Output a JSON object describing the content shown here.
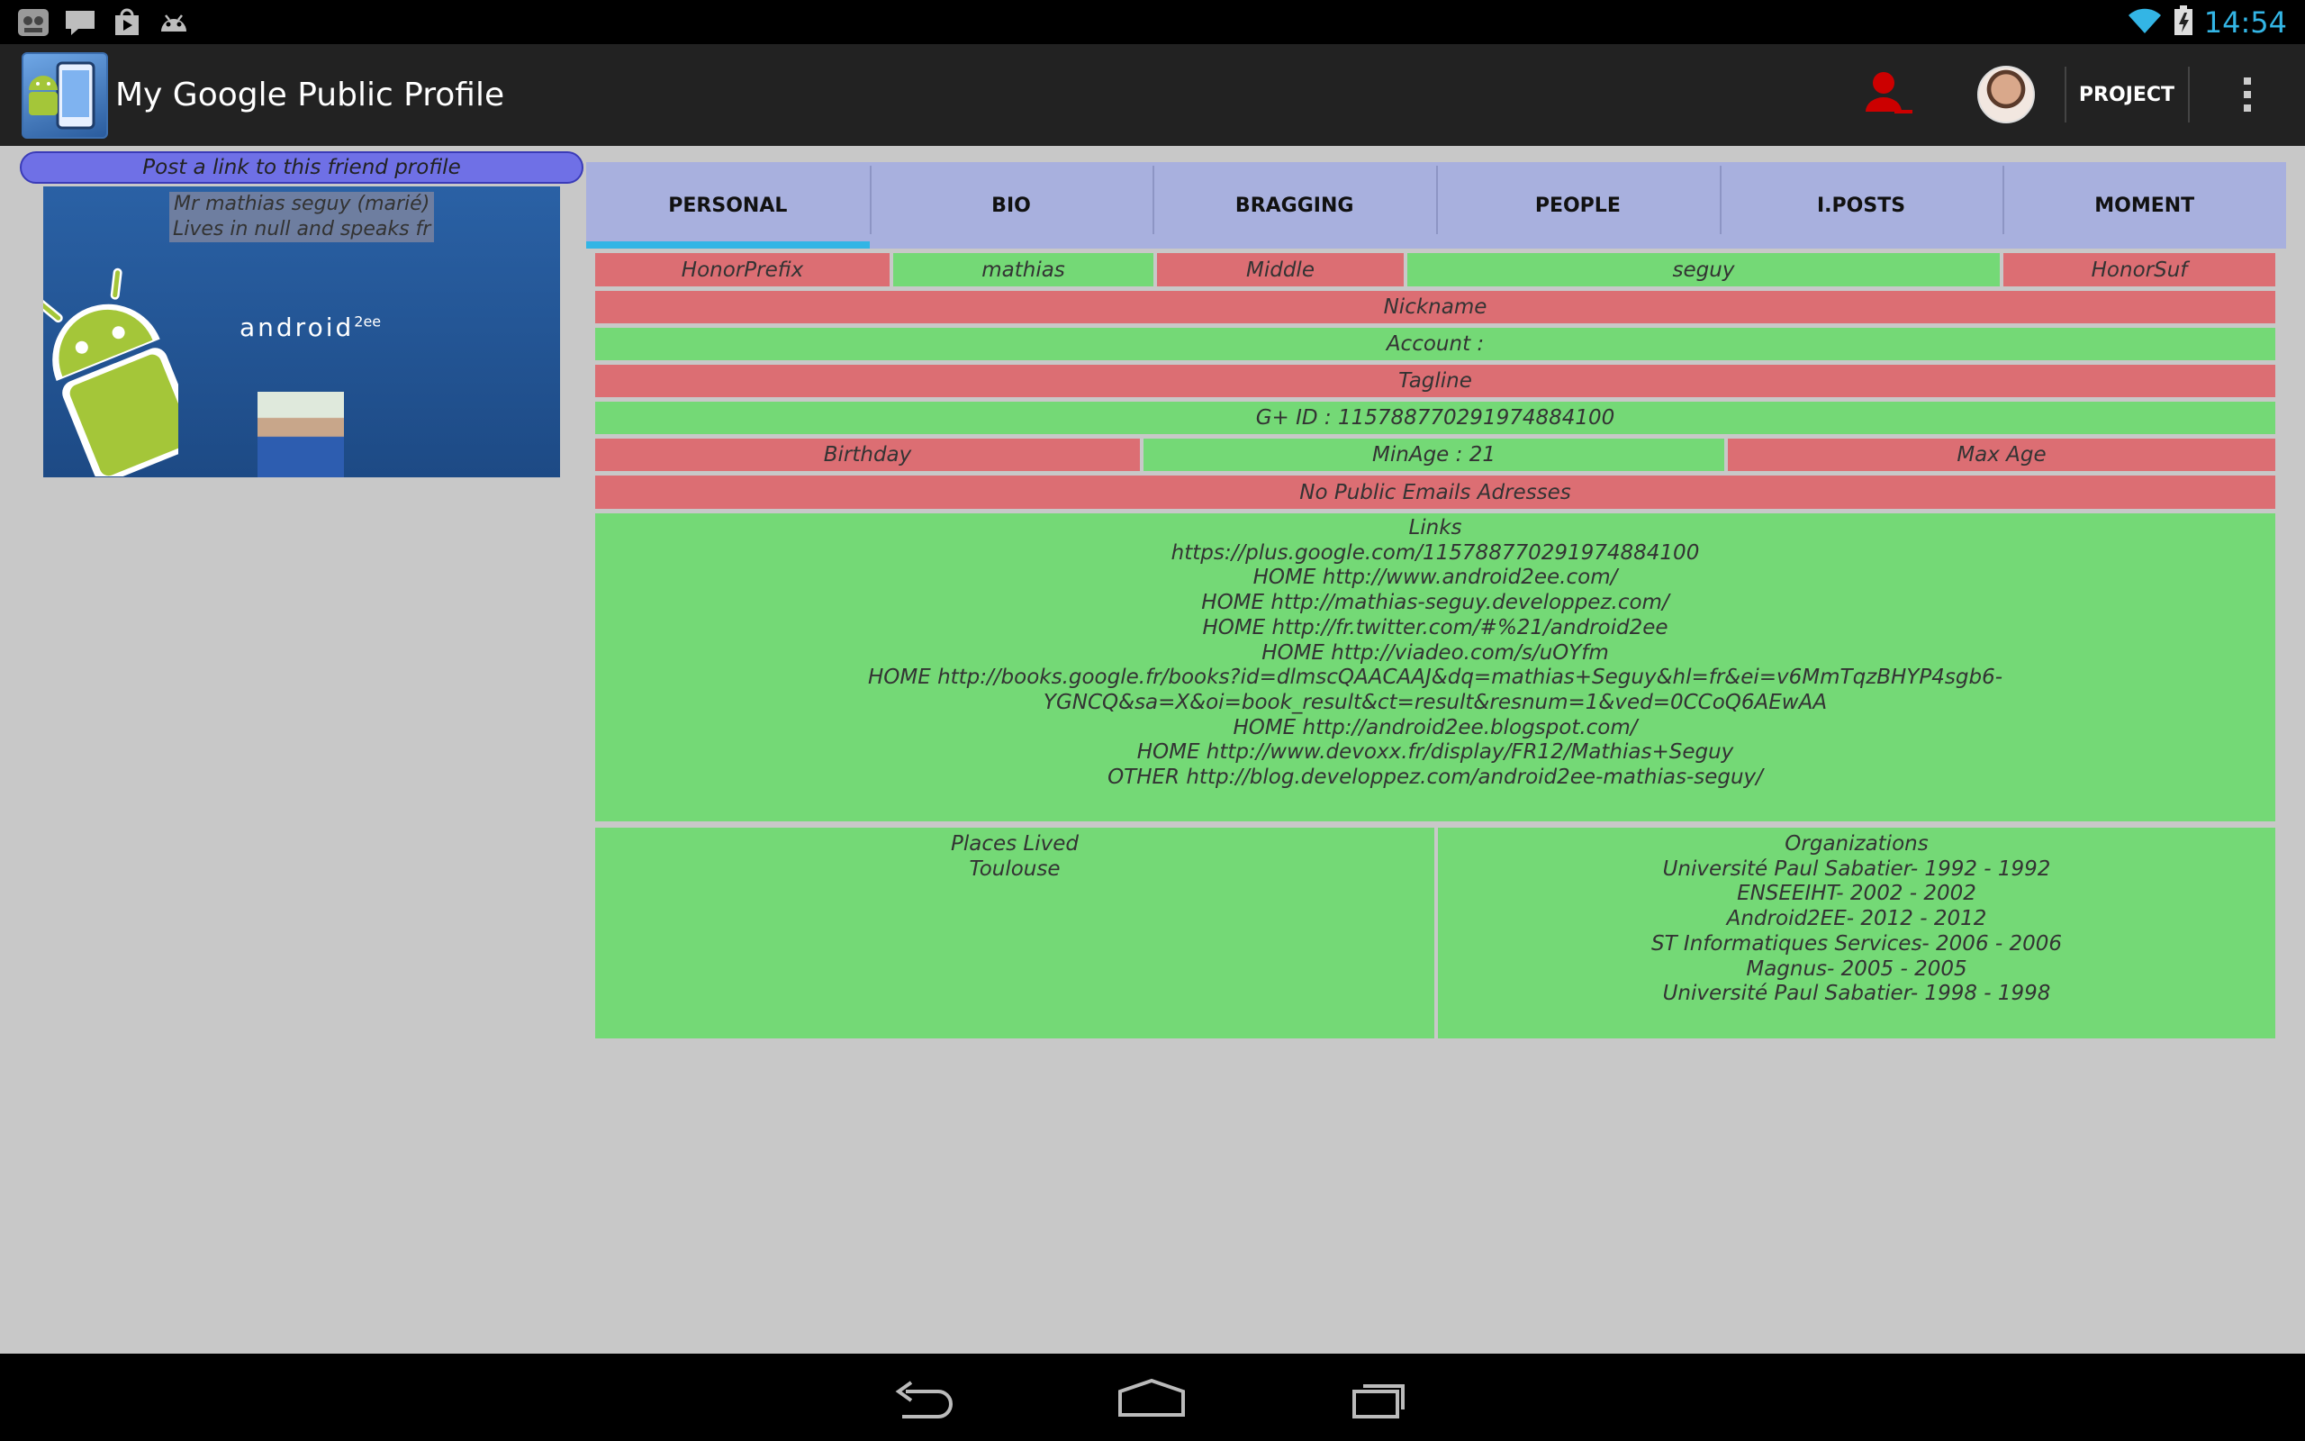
{
  "status_bar": {
    "time": "14:54",
    "notification_icons": [
      "app-icon",
      "talk-icon",
      "play-store-icon",
      "android-icon"
    ],
    "talk_label": "talk"
  },
  "action_bar": {
    "title": "My Google Public Profile",
    "project_label": "PROJECT"
  },
  "left_panel": {
    "post_link_label": "Post a link to this friend profile",
    "cover_line1": "Mr mathias seguy (marié)",
    "cover_line2": "Lives in null and speaks fr",
    "cover_brand": "android",
    "cover_brand_sup": "2ee"
  },
  "tabs": [
    {
      "label": "PERSONAL",
      "active": true
    },
    {
      "label": "BIO",
      "active": false
    },
    {
      "label": "BRAGGING",
      "active": false
    },
    {
      "label": "PEOPLE",
      "active": false
    },
    {
      "label": "I.POSTS",
      "active": false
    },
    {
      "label": "MOMENT",
      "active": false
    }
  ],
  "personal": {
    "honor_prefix": "HonorPrefix",
    "given_name": "mathias",
    "middle_name": "Middle",
    "family_name": "seguy",
    "honor_suffix": "HonorSuf",
    "nickname": "Nickname",
    "account": "Account :",
    "tagline": "Tagline",
    "gplus_id": "G+ ID : 115788770291974884100",
    "birthday": "Birthday",
    "min_age": "MinAge : 21",
    "max_age": "Max Age",
    "emails": "No Public Emails Adresses",
    "links_title": "Links",
    "links": [
      "https://plus.google.com/115788770291974884100",
      "HOME http://www.android2ee.com/",
      "HOME http://mathias-seguy.developpez.com/",
      "HOME http://fr.twitter.com/#%21/android2ee",
      "HOME http://viadeo.com/s/uOYfm",
      "HOME http://books.google.fr/books?id=dlmscQAACAAJ&dq=mathias+Seguy&hl=fr&ei=v6MmTqzBHYP4sgb6-",
      "YGNCQ&sa=X&oi=book_result&ct=result&resnum=1&ved=0CCoQ6AEwAA",
      "HOME http://android2ee.blogspot.com/",
      "HOME http://www.devoxx.fr/display/FR12/Mathias+Seguy",
      "OTHER http://blog.developpez.com/android2ee-mathias-seguy/"
    ],
    "places_title": "Places Lived",
    "places": [
      "Toulouse"
    ],
    "organizations_title": "Organizations",
    "organizations": [
      "Université Paul Sabatier- 1992 - 1992",
      "ENSEEIHT- 2002 - 2002",
      "Android2EE- 2012 - 2012",
      "ST Informatiques Services- 2006 - 2006",
      "Magnus- 2005 - 2005",
      "Université Paul Sabatier- 1998 - 1998"
    ]
  },
  "colors": {
    "missing_field": "#dc6e73",
    "present_field": "#74d976",
    "tab_bar": "#a8b0de",
    "accent": "#33b5e5"
  }
}
